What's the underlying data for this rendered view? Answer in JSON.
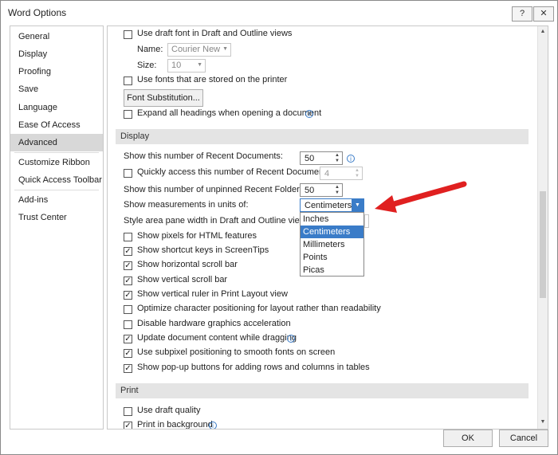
{
  "window": {
    "title": "Word Options",
    "help_label": "?",
    "close_label": "✕"
  },
  "nav": {
    "items": [
      "General",
      "Display",
      "Proofing",
      "Save",
      "Language",
      "Ease Of Access",
      "Advanced",
      "Customize Ribbon",
      "Quick Access Toolbar",
      "Add-ins",
      "Trust Center"
    ],
    "selected": "Advanced"
  },
  "show_doc_content": {
    "draft_font": {
      "label": "Use draft font in Draft and Outline views",
      "checked": false
    },
    "name_label": "Name:",
    "name_value": "Courier New",
    "size_label": "Size:",
    "size_value": "10",
    "printer_fonts": {
      "label": "Use fonts that are stored on the printer",
      "checked": false
    },
    "font_sub_button": "Font Substitution...",
    "expand_headings": {
      "label": "Expand all headings when opening a document",
      "checked": false
    }
  },
  "display": {
    "heading": "Display",
    "recent_docs_label": "Show this number of Recent Documents:",
    "recent_docs_value": "50",
    "quick_access_label": "Quickly access this number of Recent Documents:",
    "quick_access_value": "4",
    "unpinned_label": "Show this number of unpinned Recent Folders:",
    "unpinned_value": "50",
    "units_label": "Show measurements in units of:",
    "units_value": "Centimeters",
    "units_options": [
      "Inches",
      "Centimeters",
      "Millimeters",
      "Points",
      "Picas"
    ],
    "style_area_label": "Style area pane width in Draft and Outline views:",
    "checkboxes": [
      {
        "label": "Show pixels for HTML features",
        "checked": false
      },
      {
        "label": "Show shortcut keys in ScreenTips",
        "checked": true
      },
      {
        "label": "Show horizontal scroll bar",
        "checked": true
      },
      {
        "label": "Show vertical scroll bar",
        "checked": true
      },
      {
        "label": "Show vertical ruler in Print Layout view",
        "checked": true
      },
      {
        "label": "Optimize character positioning for layout rather than readability",
        "checked": false
      },
      {
        "label": "Disable hardware graphics acceleration",
        "checked": false
      },
      {
        "label": "Update document content while dragging",
        "checked": true
      },
      {
        "label": "Use subpixel positioning to smooth fonts on screen",
        "checked": true
      },
      {
        "label": "Show pop-up buttons for adding rows and columns in tables",
        "checked": true
      }
    ]
  },
  "print": {
    "heading": "Print",
    "draft_quality": {
      "label": "Use draft quality",
      "checked": false
    },
    "background": {
      "label": "Print in background",
      "checked": true
    }
  },
  "footer": {
    "ok_label": "OK",
    "cancel_label": "Cancel"
  },
  "colors": {
    "accent": "#3a7cc8",
    "arrow": "#e02020",
    "section_bg": "#e4e4e4",
    "nav_selected": "#d8d8d8"
  },
  "icons": {
    "info": "info-icon",
    "check": "check-icon",
    "dropdown": "chevron-down-icon"
  }
}
